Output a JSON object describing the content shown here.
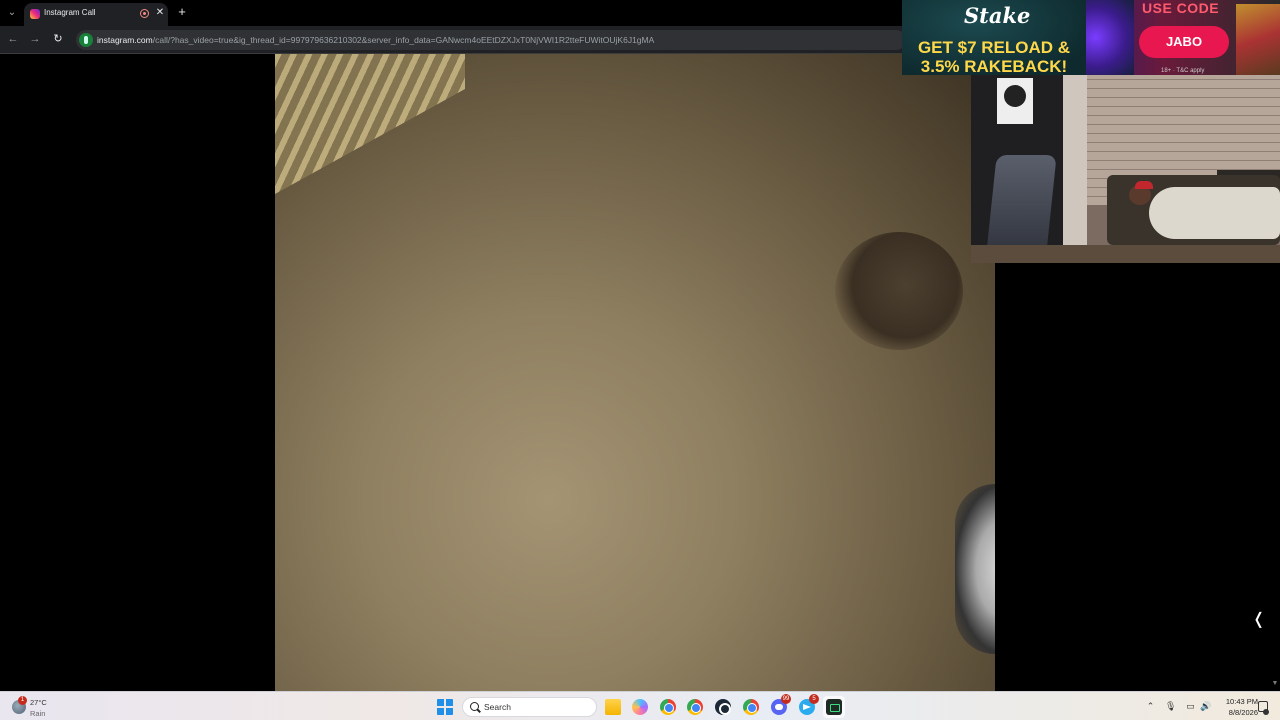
{
  "browser": {
    "tab": {
      "title": "Instagram Call",
      "favicon": "instagram-icon",
      "close_glyph": "✕"
    },
    "new_tab_glyph": "+",
    "tab_list_glyph": "⌄",
    "nav": {
      "back": "←",
      "forward": "→",
      "reload": "↻"
    },
    "address_bar": {
      "host": "instagram.com",
      "path": "/call/?has_video=true&ig_thread_id=997979636210302&server_info_data=GANwcm4oEEtDZXJxT0NjVWI1R2tteFUWitOUjK6J1gMA"
    }
  },
  "stream_overlay": {
    "ad": {
      "brand": "Stake",
      "headline_line1": "GET $7 RELOAD &",
      "headline_line2": "3.5% RAKEBACK!",
      "use_code_label": "USE CODE",
      "code": "JABO",
      "terms": "18+ · T&C apply"
    }
  },
  "page": {
    "collapse_glyph": "❬",
    "scroll_glyph": "▼"
  },
  "taskbar": {
    "weather": {
      "temperature": "27°C",
      "condition": "Rain",
      "badge": "1"
    },
    "search_placeholder": "Search",
    "apps": [
      {
        "name": "File Explorer",
        "icon": "folder-icon"
      },
      {
        "name": "Copilot",
        "icon": "copilot-icon"
      },
      {
        "name": "Google Chrome",
        "icon": "chrome-icon"
      },
      {
        "name": "Google Chrome",
        "icon": "chrome-icon"
      },
      {
        "name": "Steam",
        "icon": "steam-icon"
      },
      {
        "name": "Google Chrome",
        "icon": "chrome-icon"
      },
      {
        "name": "Discord",
        "icon": "discord-icon",
        "badge": "99"
      },
      {
        "name": "Telegram",
        "icon": "telegram-icon",
        "badge": "5"
      },
      {
        "name": "Terminal",
        "icon": "terminal-icon"
      }
    ],
    "tray": {
      "chevron": "⌃",
      "mic": "🎙",
      "network": "▭",
      "volume": "🔊"
    },
    "clock": {
      "time": "10:43 PM",
      "date": "8/8/2026"
    }
  }
}
